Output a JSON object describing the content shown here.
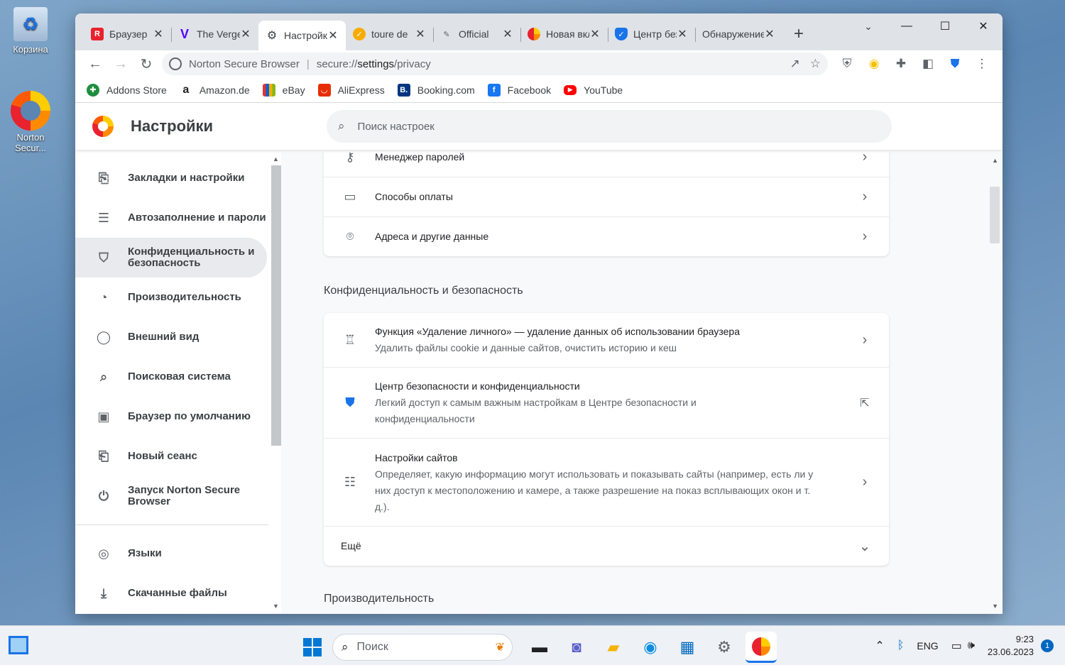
{
  "desktop": {
    "recycle_label": "Корзина",
    "norton_label": "Norton Secur..."
  },
  "tabs": [
    {
      "title": "Браузер",
      "fav": "R",
      "color": "#e8222e"
    },
    {
      "title": "The Verge",
      "fav": "V",
      "color": "#5200ff"
    },
    {
      "title": "Настройки",
      "fav": "⚙",
      "color": "#3c4043"
    },
    {
      "title": "toure de",
      "fav": "✓",
      "color": "#f9ab00"
    },
    {
      "title": "Official",
      "fav": "✎",
      "color": "#5f6368"
    },
    {
      "title": "Новая вкладка",
      "fav": "●",
      "color": "#ff6d00"
    },
    {
      "title": "Центр безопасности",
      "fav": "✓",
      "color": "#1a73e8"
    },
    {
      "title": "Обнаружение",
      "fav": "",
      "color": "#ffffff"
    }
  ],
  "window_controls": {
    "minimize": "—",
    "maximize": "☐",
    "close": "✕"
  },
  "toolbar": {
    "site_name": "Norton Secure Browser",
    "url_scheme": "secure://",
    "url_host": "settings",
    "url_path": "/privacy"
  },
  "bookmarks": [
    {
      "label": "Addons Store",
      "fav": "✚",
      "color": "#1e8e3e"
    },
    {
      "label": "Amazon.de",
      "fav": "a",
      "color": "#202124"
    },
    {
      "label": "eBay",
      "fav": "▇",
      "color": "#e53238"
    },
    {
      "label": "AliExpress",
      "fav": "A",
      "color": "#e62e04"
    },
    {
      "label": "Booking.com",
      "fav": "B.",
      "color": "#003580"
    },
    {
      "label": "Facebook",
      "fav": "f",
      "color": "#1877f2"
    },
    {
      "label": "YouTube",
      "fav": "▶",
      "color": "#ff0000"
    }
  ],
  "settings": {
    "title": "Настройки",
    "search_placeholder": "Поиск настроек"
  },
  "sidebar": {
    "items": [
      {
        "label": "Закладки и настройки",
        "icon": "bookmark-icon"
      },
      {
        "label": "Автозаполнение и пароли",
        "icon": "list-icon"
      },
      {
        "label": "Конфиденциальность и безопасность",
        "icon": "shield-icon"
      },
      {
        "label": "Производительность",
        "icon": "speedometer-icon"
      },
      {
        "label": "Внешний вид",
        "icon": "palette-icon"
      },
      {
        "label": "Поисковая система",
        "icon": "search-icon"
      },
      {
        "label": "Браузер по умолчанию",
        "icon": "browser-icon"
      },
      {
        "label": "Новый сеанс",
        "icon": "power-icon"
      },
      {
        "label": "Запуск Norton Secure Browser",
        "icon": "power-icon"
      },
      {
        "label": "Языки",
        "icon": "globe-icon"
      },
      {
        "label": "Скачанные файлы",
        "icon": "download-icon"
      }
    ]
  },
  "autofill_rows": [
    {
      "label": "Менеджер паролей",
      "icon": "key-icon"
    },
    {
      "label": "Способы оплаты",
      "icon": "card-icon"
    },
    {
      "label": "Адреса и другие данные",
      "icon": "location-icon"
    }
  ],
  "privacy": {
    "section_title": "Конфиденциальность и безопасность",
    "rows": [
      {
        "title": "Функция «Удаление личного» — удаление данных об использовании браузера",
        "sub": "Удалить файлы cookie и данные сайтов, очистить историю и кеш"
      },
      {
        "title": "Центр безопасности и конфиденциальности",
        "sub": "Легкий доступ к самым важным настройкам в Центре безопасности и конфиденциальности"
      },
      {
        "title": "Настройки сайтов",
        "sub": "Определяет, какую информацию могут использовать и показывать сайты (например, есть ли у них доступ к местоположению и камере, а также разрешение на показ всплывающих окон и т. д.)."
      }
    ],
    "more_label": "Ещё"
  },
  "performance_section_title": "Производительность",
  "taskbar": {
    "search_placeholder": "Поиск",
    "lang": "ENG",
    "time": "9:23",
    "date": "23.06.2023",
    "notifications": "1"
  }
}
